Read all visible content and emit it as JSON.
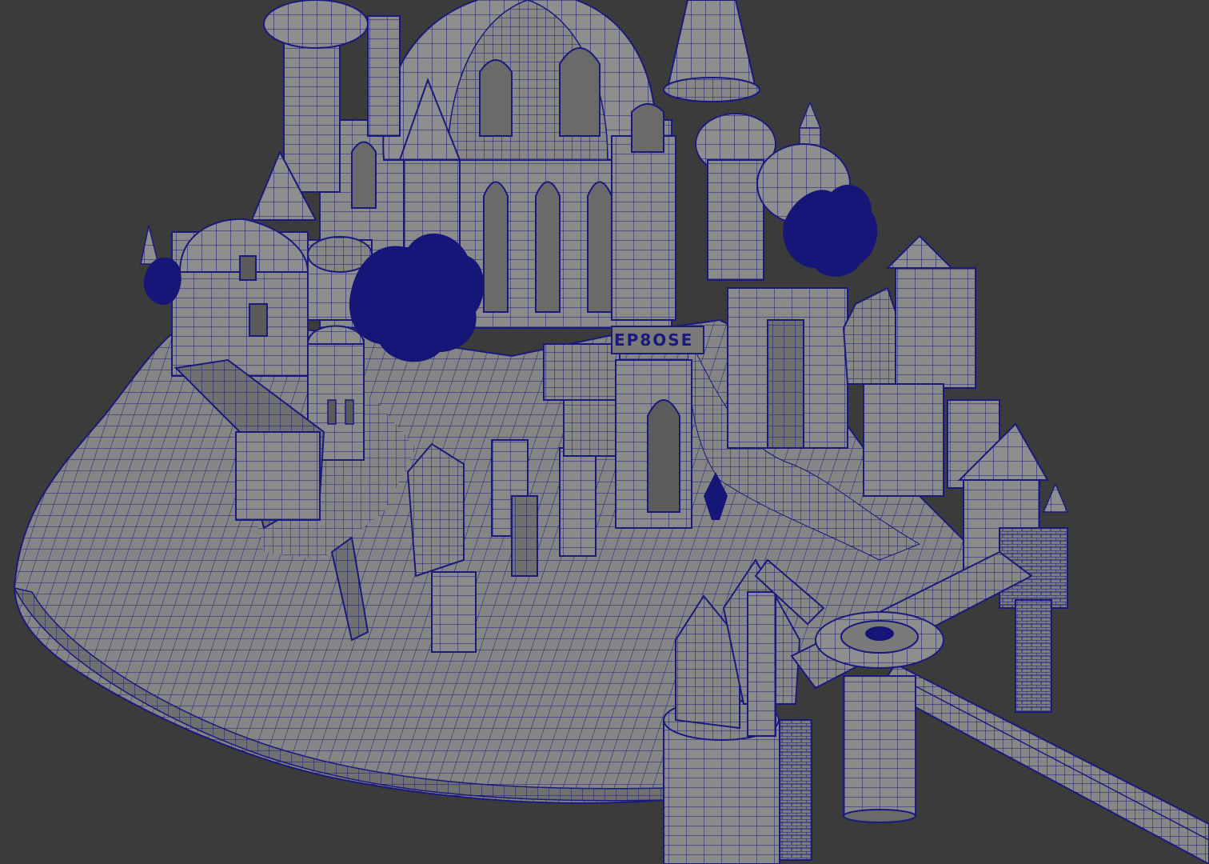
{
  "viewport": {
    "background": "#3b3b3b",
    "mesh_fill": "#8e8e8e",
    "mesh_shade": "#6f6f6f",
    "mesh_dark": "#5a5a5a",
    "wire_color": "#1a1a7c",
    "foliage_color": "#161678"
  },
  "sign_text": "EP8OSE"
}
